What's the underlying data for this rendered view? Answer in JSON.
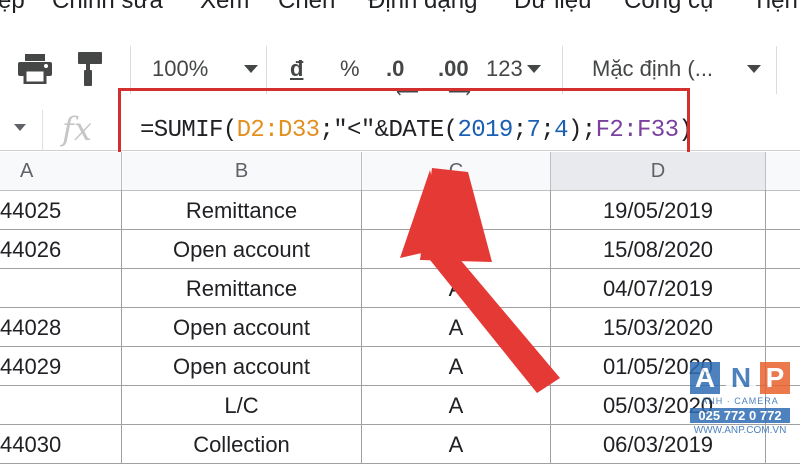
{
  "menubar": {
    "items": [
      "ệp",
      "Chỉnh sửa",
      "Xem",
      "Chèn",
      "Định dạng",
      "Dữ liệu",
      "Công cụ",
      "Tiện"
    ]
  },
  "toolbar": {
    "print_icon": "print-icon",
    "paint_format_icon": "paint-format-icon",
    "zoom": "100%",
    "currency": "đ",
    "percent": "%",
    "decrease_decimal": ".0",
    "increase_decimal": ".00",
    "number_format": "123",
    "font": "Mặc định (..."
  },
  "formula_bar": {
    "fx": "fx",
    "formula_parts": [
      {
        "text": "=SUMIF(",
        "color": "#202124"
      },
      {
        "text": "D2:D33",
        "color": "#e49020"
      },
      {
        "text": ";\"<\"&DATE(",
        "color": "#202124"
      },
      {
        "text": "2019",
        "color": "#1a5fb4"
      },
      {
        "text": ";",
        "color": "#202124"
      },
      {
        "text": "7",
        "color": "#1a5fb4"
      },
      {
        "text": ";",
        "color": "#202124"
      },
      {
        "text": "4",
        "color": "#1a5fb4"
      },
      {
        "text": ");",
        "color": "#202124"
      },
      {
        "text": "F2:F33",
        "color": "#7b3fa0"
      },
      {
        "text": ")",
        "color": "#202124"
      }
    ]
  },
  "columns": [
    "A",
    "B",
    "C",
    "D"
  ],
  "rows": [
    {
      "a": "44025",
      "b": "Remittance",
      "c": "",
      "d": "19/05/2019"
    },
    {
      "a": "44026",
      "b": "Open account",
      "c": "",
      "d": "15/08/2020"
    },
    {
      "a": "",
      "b": "Remittance",
      "c": "A",
      "d": "04/07/2019"
    },
    {
      "a": "44028",
      "b": "Open account",
      "c": "A",
      "d": "15/03/2020"
    },
    {
      "a": "44029",
      "b": "Open account",
      "c": "A",
      "d": "01/05/2020"
    },
    {
      "a": "",
      "b": "L/C",
      "c": "A",
      "d": "05/03/2020"
    },
    {
      "a": "44030",
      "b": "Collection",
      "c": "A",
      "d": "06/03/2019"
    }
  ],
  "watermark": {
    "letters": [
      "A",
      "N",
      "P"
    ],
    "sub": "ANH · CAMERA",
    "phone": "025 772 0 772",
    "url": "WWW.ANP.COM.VN"
  },
  "colors": {
    "highlight": "#d32f2f",
    "arrow": "#e53935"
  }
}
